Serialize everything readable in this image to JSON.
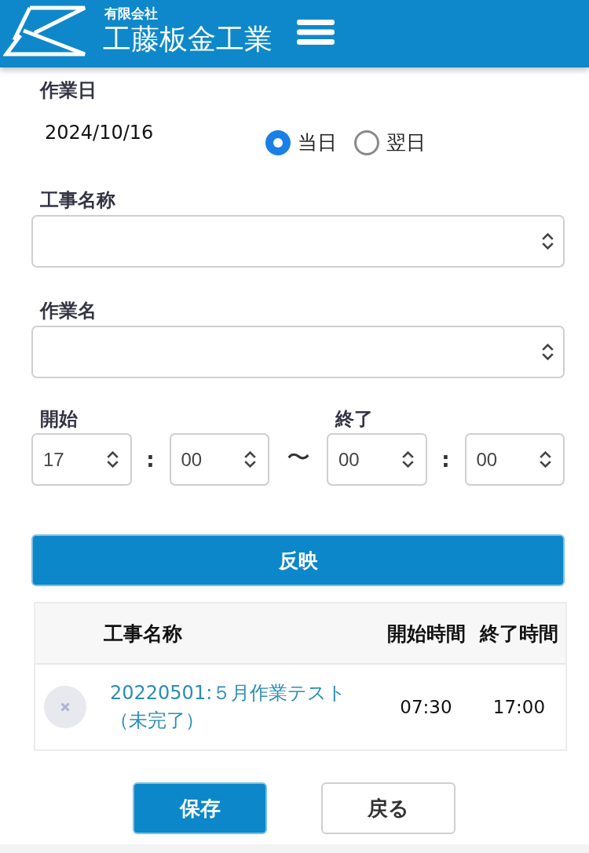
{
  "header": {
    "company_type": "有限会社",
    "company_name": "工藤板金工業"
  },
  "work_date": {
    "label": "作業日",
    "value": "2024/10/16",
    "options": [
      {
        "label": "当日",
        "selected": true
      },
      {
        "label": "翌日",
        "selected": false
      }
    ]
  },
  "selects": [
    {
      "label": "工事名称"
    },
    {
      "label": "作業名"
    }
  ],
  "time_range": {
    "start_label": "開始",
    "end_label": "終了",
    "start_hour": "17",
    "start_separator": ":",
    "start_minute": "00",
    "range_mark": "〜",
    "end_hour": "00",
    "end_separator": ":",
    "end_minute": "00"
  },
  "apply_button": "反映",
  "table": {
    "columns": [
      "工事名称",
      "開始時間",
      "終了時間"
    ],
    "rows": [
      {
        "name": "20220501:５月作業テスト（未完了）",
        "start": "07:30",
        "end": "17:00"
      }
    ]
  },
  "buttons": [
    {
      "label": "保存",
      "kind": "primary"
    },
    {
      "label": "戻る",
      "kind": "secondary"
    }
  ]
}
